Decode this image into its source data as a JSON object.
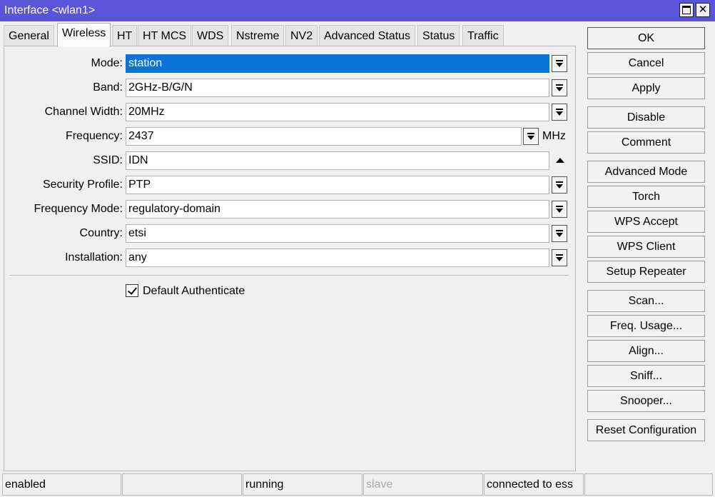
{
  "window": {
    "title": "Interface <wlan1>",
    "maximize_icon": "maximize-icon",
    "close_glyph": "✕"
  },
  "tabs": [
    {
      "label": "General"
    },
    {
      "label": "Wireless",
      "active": true
    },
    {
      "label": "HT"
    },
    {
      "label": "HT MCS"
    },
    {
      "label": "WDS"
    },
    {
      "label": "Nstreme"
    },
    {
      "label": "NV2"
    },
    {
      "label": "Advanced Status"
    },
    {
      "label": "Status"
    },
    {
      "label": "Traffic"
    }
  ],
  "form": {
    "mode": {
      "label": "Mode:",
      "value": "station"
    },
    "band": {
      "label": "Band:",
      "value": "2GHz-B/G/N"
    },
    "channel_width": {
      "label": "Channel Width:",
      "value": "20MHz"
    },
    "frequency": {
      "label": "Frequency:",
      "value": "2437",
      "unit": "MHz"
    },
    "ssid": {
      "label": "SSID:",
      "value": "IDN"
    },
    "security_profile": {
      "label": "Security Profile:",
      "value": "PTP"
    },
    "frequency_mode": {
      "label": "Frequency Mode:",
      "value": "regulatory-domain"
    },
    "country": {
      "label": "Country:",
      "value": "etsi"
    },
    "installation": {
      "label": "Installation:",
      "value": "any"
    },
    "default_authenticate": {
      "label": "Default Authenticate",
      "checked": true
    }
  },
  "buttons": {
    "ok": "OK",
    "cancel": "Cancel",
    "apply": "Apply",
    "disable": "Disable",
    "comment": "Comment",
    "advanced_mode": "Advanced Mode",
    "torch": "Torch",
    "wps_accept": "WPS Accept",
    "wps_client": "WPS Client",
    "setup_repeater": "Setup Repeater",
    "scan": "Scan...",
    "freq_usage": "Freq. Usage...",
    "align": "Align...",
    "sniff": "Sniff...",
    "snooper": "Snooper...",
    "reset_configuration": "Reset Configuration"
  },
  "status": {
    "enabled": "enabled",
    "cell2": "",
    "running": "running",
    "slave": "slave",
    "connection": "connected to ess",
    "cell6": ""
  },
  "colors": {
    "titlebar": "#5a55d8",
    "selection": "#0a74d6",
    "dim_text": "#a8a8a8"
  }
}
